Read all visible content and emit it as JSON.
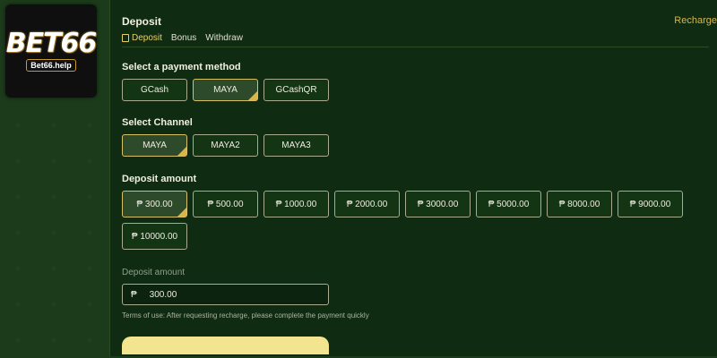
{
  "logo": {
    "main": "BET66",
    "sub": "Bet66.help"
  },
  "header": {
    "title": "Deposit",
    "recharge_link": "Recharge"
  },
  "tabs": [
    {
      "label": "Deposit",
      "active": true
    },
    {
      "label": "Bonus",
      "active": false
    },
    {
      "label": "Withdraw",
      "active": false
    }
  ],
  "payment": {
    "label": "Select a payment method",
    "options": [
      "GCash",
      "MAYA",
      "GCashQR"
    ],
    "selected": "MAYA"
  },
  "channel": {
    "label": "Select Channel",
    "options": [
      "MAYA",
      "MAYA2",
      "MAYA3"
    ],
    "selected": "MAYA"
  },
  "amount": {
    "label": "Deposit amount",
    "options": [
      "₱ 300.00",
      "₱ 500.00",
      "₱ 1000.00",
      "₱ 2000.00",
      "₱ 3000.00",
      "₱ 5000.00",
      "₱ 8000.00",
      "₱ 9000.00",
      "₱ 10000.00"
    ],
    "selected": "₱ 300.00"
  },
  "input": {
    "label": "Deposit amount",
    "currency": "₱",
    "value": "300.00"
  },
  "terms": "Terms of use:  After requesting recharge, please complete the payment quickly",
  "colors": {
    "accent": "#d9b64a",
    "panel": "#0f2b12",
    "button_primary": "#f3e48f"
  }
}
